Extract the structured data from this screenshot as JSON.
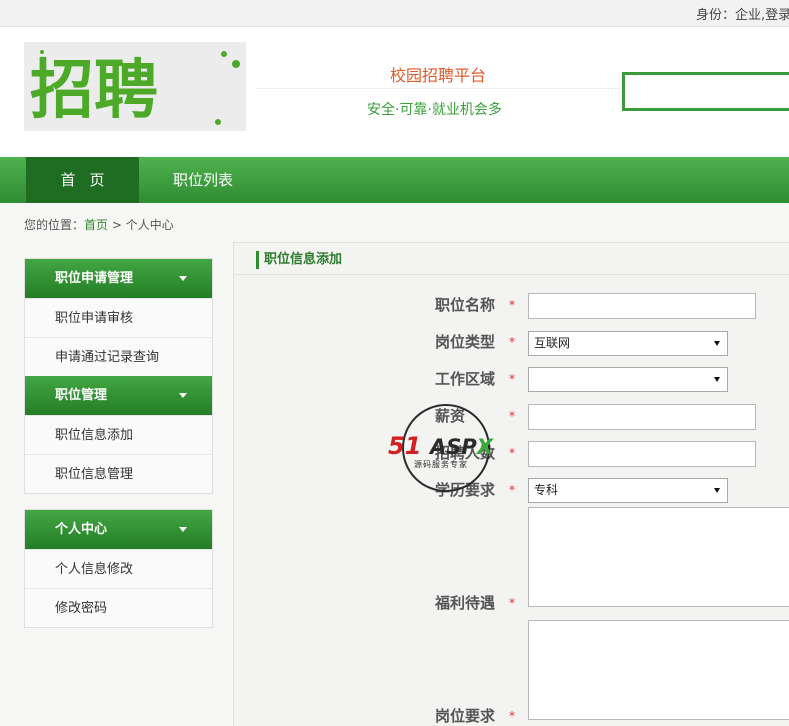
{
  "topbar": {
    "user_text": "身份：企业,登录"
  },
  "header": {
    "logo_text": "招聘",
    "site_name": "校园招聘平台",
    "slogan": "安全·可靠·就业机会多",
    "search_value": ""
  },
  "nav": {
    "home": "首页",
    "jobs": "职位列表"
  },
  "breadcrumb": {
    "prefix": "您的位置：",
    "home": "首页",
    "sep": " > ",
    "current": "个人中心"
  },
  "sidebar": {
    "groups": [
      {
        "title": "职位申请管理",
        "items": [
          "职位申请审核",
          "申请通过记录查询"
        ]
      },
      {
        "title": "职位管理",
        "items": [
          "职位信息添加",
          "职位信息管理"
        ]
      },
      {
        "title": "个人中心",
        "items": [
          "个人信息修改",
          "修改密码"
        ]
      }
    ]
  },
  "form": {
    "title": "职位信息添加",
    "required_mark": "*",
    "fields": {
      "job_name": {
        "label": "职位名称",
        "value": ""
      },
      "job_type": {
        "label": "岗位类型",
        "value": "互联网"
      },
      "work_area": {
        "label": "工作区域",
        "value": ""
      },
      "salary": {
        "label": "薪资",
        "value": ""
      },
      "headcount": {
        "label": "招聘人数",
        "value": ""
      },
      "education": {
        "label": "学历要求",
        "value": "专科"
      },
      "benefits": {
        "label": "福利待遇",
        "value": ""
      },
      "requirements": {
        "label": "岗位要求",
        "value": ""
      }
    }
  },
  "watermark": {
    "brand_num": "51",
    "brand_name": "ASP",
    "brand_x": "X",
    "subtitle": "源码服务专家"
  },
  "colors": {
    "primary_green": "#2f8d32",
    "accent_orange": "#e0592a",
    "required_red": "#e03030"
  }
}
